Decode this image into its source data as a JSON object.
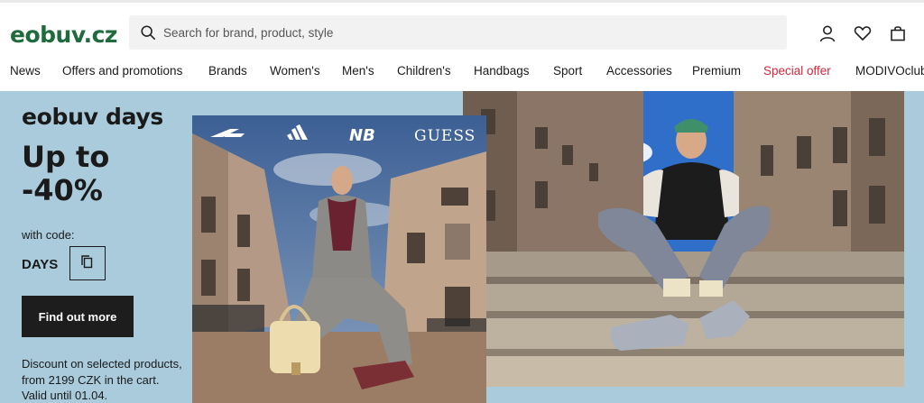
{
  "header": {
    "logo_main": "eobuv",
    "logo_tld": ".cz",
    "search_placeholder": "Search for brand, product, style",
    "icons": [
      "search-icon",
      "user-icon",
      "heart-icon",
      "bag-icon"
    ]
  },
  "nav": {
    "items": [
      {
        "label": "News"
      },
      {
        "label": "Offers and promotions"
      },
      {
        "label": "Brands"
      },
      {
        "label": "Women's"
      },
      {
        "label": "Men's"
      },
      {
        "label": "Children's"
      },
      {
        "label": "Handbags"
      },
      {
        "label": "Sport"
      },
      {
        "label": "Accessories"
      },
      {
        "label": "Premium"
      },
      {
        "label": "Special offer",
        "color": "#d6263b"
      },
      {
        "label": "MODIVOclub"
      }
    ]
  },
  "hero": {
    "title": "eobuv days",
    "discount": "Up to -40%",
    "code_label": "with code:",
    "code": "DAYS",
    "cta_label": "Find out more",
    "note": "Discount on selected products, from 2199 CZK in the cart. Valid until 01.04.",
    "brand_logos": [
      "Reebok",
      "adidas",
      "New Balance",
      "GUESS"
    ],
    "background_color": "#a9cbdc",
    "images": [
      "woman-on-steps-photo",
      "man-on-steps-photo"
    ]
  },
  "colors": {
    "brand": "#1f6b3d",
    "special_offer": "#d6263b",
    "cta_bg": "#1d1d1d"
  }
}
